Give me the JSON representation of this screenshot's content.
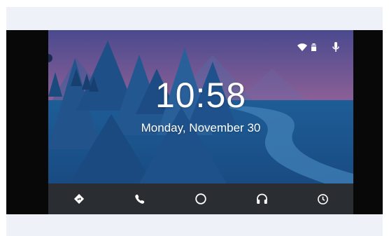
{
  "screen": {
    "time": "10:58",
    "date": "Monday, November 30"
  },
  "status_bar": {
    "icons": [
      "wifi-icon",
      "battery-icon",
      "microphone-icon"
    ]
  },
  "navbar": {
    "items": [
      {
        "name": "navigation",
        "icon": "navigation-diamond-icon"
      },
      {
        "name": "phone",
        "icon": "phone-icon"
      },
      {
        "name": "home",
        "icon": "home-circle-icon"
      },
      {
        "name": "music",
        "icon": "headphones-icon"
      },
      {
        "name": "overview",
        "icon": "clock-icon"
      }
    ]
  },
  "colors": {
    "sky_top": "#5a4f92",
    "sky_pink": "#c86f8e",
    "water": "#1d5b93",
    "navbar_bg": "#2a2d31",
    "frame": "#080808",
    "band": "#eef2f8"
  }
}
